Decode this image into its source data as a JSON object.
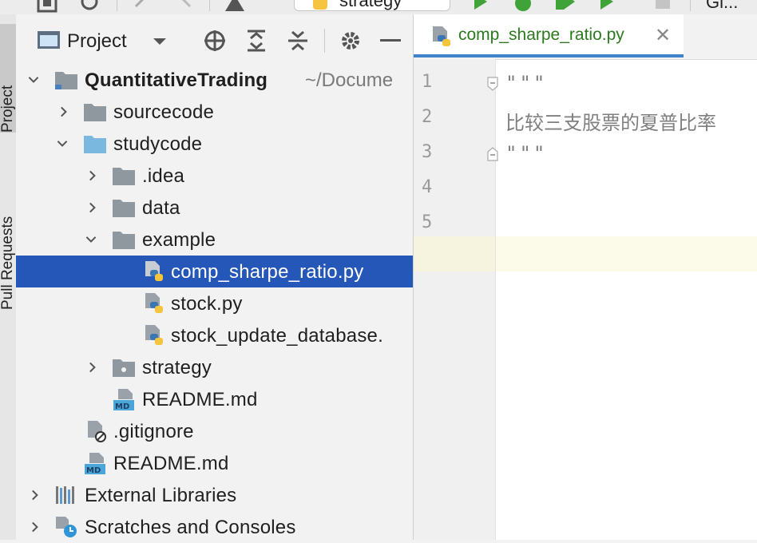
{
  "toolbar": {
    "run_config": "strategy",
    "right_text": "Gi..."
  },
  "left_strip": {
    "tabs": [
      {
        "label": "Project",
        "active": true
      },
      {
        "label": "Pull Requests",
        "active": false
      }
    ]
  },
  "project_panel": {
    "title": "Project",
    "tree": [
      {
        "label": "QuantitativeTrading",
        "hint": "~/Docume",
        "bold": true
      },
      {
        "label": "sourcecode"
      },
      {
        "label": "studycode"
      },
      {
        "label": ".idea"
      },
      {
        "label": "data"
      },
      {
        "label": "example"
      },
      {
        "label": "comp_sharpe_ratio.py",
        "selected": true
      },
      {
        "label": "stock.py"
      },
      {
        "label": "stock_update_database."
      },
      {
        "label": "strategy"
      },
      {
        "label": "README.md"
      },
      {
        "label": ".gitignore"
      },
      {
        "label": "README.md"
      },
      {
        "label": "External Libraries"
      },
      {
        "label": "Scratches and Consoles"
      }
    ]
  },
  "editor": {
    "tab_label": "comp_sharpe_ratio.py",
    "line_numbers": [
      "1",
      "2",
      "3",
      "4",
      "5"
    ],
    "lines": [
      "\"\"\"",
      "比较三支股票的夏普比率",
      "\"\"\"",
      "",
      ""
    ],
    "current_line": 5
  },
  "colors": {
    "selection": "#2457b7",
    "tab_text": "#2b7a1e",
    "tab_underline": "#4083c9",
    "caret_line": "#fcfae9"
  }
}
